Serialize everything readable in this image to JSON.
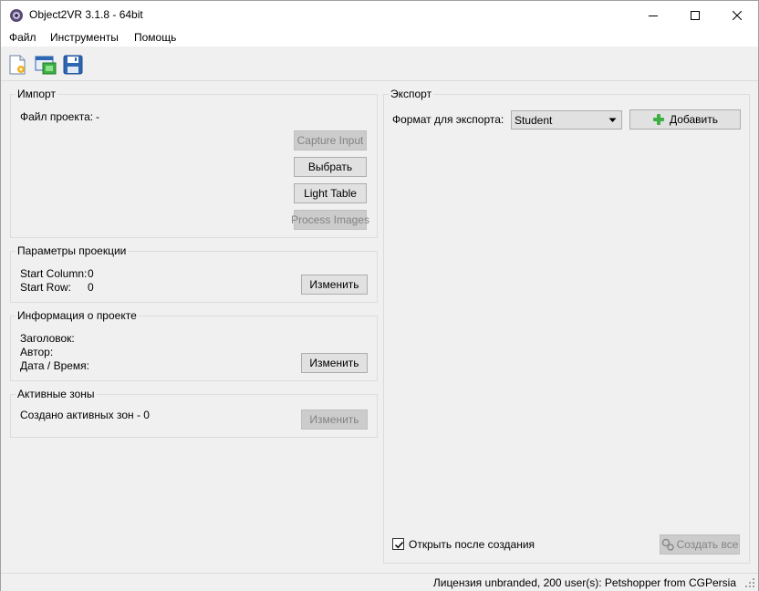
{
  "window": {
    "title": "Object2VR 3.1.8 - 64bit"
  },
  "menu": {
    "file": "Файл",
    "tools": "Инструменты",
    "help": "Помощь"
  },
  "toolbar": {
    "new_icon": "new-project-icon",
    "open_icon": "open-project-icon",
    "save_icon": "save-icon"
  },
  "import": {
    "title": "Импорт",
    "project_file_label": "Файл проекта:",
    "project_file_value": "-",
    "capture_input": "Capture Input",
    "choose": "Выбрать",
    "light_table": "Light Table",
    "process_images": "Process Images"
  },
  "projection": {
    "title": "Параметры проекции",
    "start_column_label": "Start Column:",
    "start_column_value": "0",
    "start_row_label": "Start Row:",
    "start_row_value": "0",
    "change": "Изменить"
  },
  "project_info": {
    "title": "Информация о проекте",
    "heading_label": "Заголовок:",
    "author_label": "Автор:",
    "datetime_label": "Дата / Время:",
    "change": "Изменить"
  },
  "hotspots": {
    "title": "Активные зоны",
    "created_text": "Создано активных зон - 0",
    "change": "Изменить"
  },
  "export": {
    "title": "Экспорт",
    "format_label": "Формат для экспорта:",
    "format_value": "Student",
    "add": "Добавить",
    "open_after": "Открыть после создания",
    "open_after_checked": true,
    "create_all": "Создать все"
  },
  "status": {
    "license": "Лицензия unbranded, 200 user(s): Petshopper from CGPersia"
  },
  "colors": {
    "accent_green": "#3cb043",
    "disabled_text": "#838383"
  }
}
